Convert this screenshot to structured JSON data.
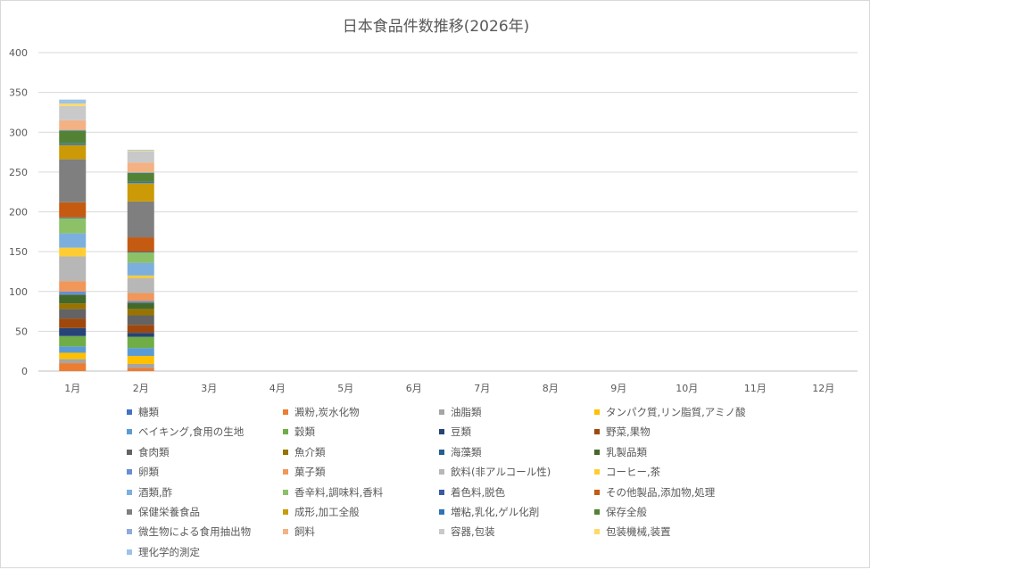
{
  "chart_data": {
    "type": "bar",
    "stacked": true,
    "title": "日本食品件数推移(2026年)",
    "xlabel": "",
    "ylabel": "",
    "ylim": [
      0,
      400
    ],
    "yticks": [
      0,
      50,
      100,
      150,
      200,
      250,
      300,
      350,
      400
    ],
    "grid": true,
    "legend_position": "bottom",
    "categories": [
      "1月",
      "2月",
      "3月",
      "4月",
      "5月",
      "6月",
      "7月",
      "8月",
      "9月",
      "10月",
      "11月",
      "12月"
    ],
    "series": [
      {
        "name": "糖類",
        "color": "#4472c4",
        "values": [
          0,
          0,
          null,
          null,
          null,
          null,
          null,
          null,
          null,
          null,
          null,
          null
        ]
      },
      {
        "name": "澱粉,炭水化物",
        "color": "#ed7d31",
        "values": [
          10,
          4,
          null,
          null,
          null,
          null,
          null,
          null,
          null,
          null,
          null,
          null
        ]
      },
      {
        "name": "油脂類",
        "color": "#a5a5a5",
        "values": [
          5,
          5,
          null,
          null,
          null,
          null,
          null,
          null,
          null,
          null,
          null,
          null
        ]
      },
      {
        "name": "タンパク質,リン脂質,アミノ酸",
        "color": "#ffc000",
        "values": [
          8,
          10,
          null,
          null,
          null,
          null,
          null,
          null,
          null,
          null,
          null,
          null
        ]
      },
      {
        "name": "ベイキング,食用の生地",
        "color": "#5b9bd5",
        "values": [
          8,
          10,
          null,
          null,
          null,
          null,
          null,
          null,
          null,
          null,
          null,
          null
        ]
      },
      {
        "name": "穀類",
        "color": "#70ad47",
        "values": [
          13,
          14,
          null,
          null,
          null,
          null,
          null,
          null,
          null,
          null,
          null,
          null
        ]
      },
      {
        "name": "豆類",
        "color": "#264478",
        "values": [
          10,
          5,
          null,
          null,
          null,
          null,
          null,
          null,
          null,
          null,
          null,
          null
        ]
      },
      {
        "name": "野菜,果物",
        "color": "#9e480e",
        "values": [
          12,
          10,
          null,
          null,
          null,
          null,
          null,
          null,
          null,
          null,
          null,
          null
        ]
      },
      {
        "name": "食肉類",
        "color": "#636363",
        "values": [
          12,
          12,
          null,
          null,
          null,
          null,
          null,
          null,
          null,
          null,
          null,
          null
        ]
      },
      {
        "name": "魚介類",
        "color": "#997300",
        "values": [
          7,
          8,
          null,
          null,
          null,
          null,
          null,
          null,
          null,
          null,
          null,
          null
        ]
      },
      {
        "name": "海藻類",
        "color": "#255e91",
        "values": [
          0,
          0,
          null,
          null,
          null,
          null,
          null,
          null,
          null,
          null,
          null,
          null
        ]
      },
      {
        "name": "乳製品類",
        "color": "#43682b",
        "values": [
          11,
          8,
          null,
          null,
          null,
          null,
          null,
          null,
          null,
          null,
          null,
          null
        ]
      },
      {
        "name": "卵類",
        "color": "#698ed0",
        "values": [
          4,
          2,
          null,
          null,
          null,
          null,
          null,
          null,
          null,
          null,
          null,
          null
        ]
      },
      {
        "name": "菓子類",
        "color": "#f1975a",
        "values": [
          13,
          10,
          null,
          null,
          null,
          null,
          null,
          null,
          null,
          null,
          null,
          null
        ]
      },
      {
        "name": "飲料(非アルコール性)",
        "color": "#b7b7b7",
        "values": [
          31,
          19,
          null,
          null,
          null,
          null,
          null,
          null,
          null,
          null,
          null,
          null
        ]
      },
      {
        "name": "コーヒー,茶",
        "color": "#ffcd33",
        "values": [
          11,
          3,
          null,
          null,
          null,
          null,
          null,
          null,
          null,
          null,
          null,
          null
        ]
      },
      {
        "name": "酒類,酢",
        "color": "#7cafdd",
        "values": [
          18,
          16,
          null,
          null,
          null,
          null,
          null,
          null,
          null,
          null,
          null,
          null
        ]
      },
      {
        "name": "香辛料,調味料,香料",
        "color": "#8cc168",
        "values": [
          19,
          13,
          null,
          null,
          null,
          null,
          null,
          null,
          null,
          null,
          null,
          null
        ]
      },
      {
        "name": "着色料,脱色",
        "color": "#3a5ba3",
        "values": [
          1,
          1,
          null,
          null,
          null,
          null,
          null,
          null,
          null,
          null,
          null,
          null
        ]
      },
      {
        "name": "その他製品,添加物,処理",
        "color": "#c55a11",
        "values": [
          19,
          18,
          null,
          null,
          null,
          null,
          null,
          null,
          null,
          null,
          null,
          null
        ]
      },
      {
        "name": "保健栄養食品",
        "color": "#7f7f7f",
        "values": [
          54,
          45,
          null,
          null,
          null,
          null,
          null,
          null,
          null,
          null,
          null,
          null
        ]
      },
      {
        "name": "成形,加工全般",
        "color": "#cc9a06",
        "values": [
          18,
          23,
          null,
          null,
          null,
          null,
          null,
          null,
          null,
          null,
          null,
          null
        ]
      },
      {
        "name": "増粘,乳化,ゲル化剤",
        "color": "#2e75b6",
        "values": [
          2,
          2,
          null,
          null,
          null,
          null,
          null,
          null,
          null,
          null,
          null,
          null
        ]
      },
      {
        "name": "保存全般",
        "color": "#548235",
        "values": [
          16,
          11,
          null,
          null,
          null,
          null,
          null,
          null,
          null,
          null,
          null,
          null
        ]
      },
      {
        "name": "微生物による食用抽出物",
        "color": "#8faadc",
        "values": [
          1,
          1,
          null,
          null,
          null,
          null,
          null,
          null,
          null,
          null,
          null,
          null
        ]
      },
      {
        "name": "飼料",
        "color": "#f4b183",
        "values": [
          12,
          12,
          null,
          null,
          null,
          null,
          null,
          null,
          null,
          null,
          null,
          null
        ]
      },
      {
        "name": "容器,包装",
        "color": "#c9c9c9",
        "values": [
          18,
          14,
          null,
          null,
          null,
          null,
          null,
          null,
          null,
          null,
          null,
          null
        ]
      },
      {
        "name": "包装機械,装置",
        "color": "#ffd966",
        "values": [
          3,
          1,
          null,
          null,
          null,
          null,
          null,
          null,
          null,
          null,
          null,
          null
        ]
      },
      {
        "name": "理化学的測定",
        "color": "#9dc3e6",
        "values": [
          5,
          1,
          null,
          null,
          null,
          null,
          null,
          null,
          null,
          null,
          null,
          null
        ]
      }
    ]
  }
}
